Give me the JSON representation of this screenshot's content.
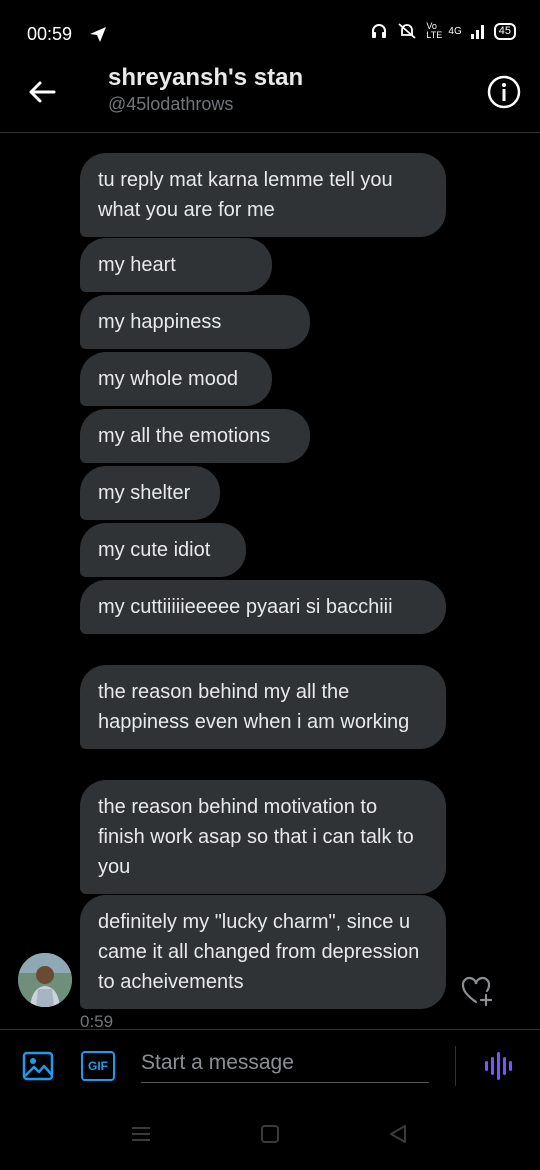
{
  "status_bar": {
    "time": "00:59",
    "battery": "45",
    "network": "4G",
    "volte": "Vo LTE"
  },
  "header": {
    "title": "shreyansh's stan",
    "handle": "@45lodathrows"
  },
  "messages": [
    {
      "text": "tu reply mat karna lemme tell you what you are for me"
    },
    {
      "text": "my heart"
    },
    {
      "text": "my happiness"
    },
    {
      "text": "my whole mood"
    },
    {
      "text": "my all the emotions"
    },
    {
      "text": "my shelter"
    },
    {
      "text": "my cute idiot"
    },
    {
      "text": "my cuttiiiiieeeee pyaari si bacchiii"
    },
    {
      "text": "the reason behind my all the happiness even when i am working"
    },
    {
      "text": "the reason behind motivation to finish work asap so that i can talk to you"
    },
    {
      "text": "definitely my \"lucky charm\", since u came it all changed from depression to acheivements"
    }
  ],
  "last_message_time": "0:59",
  "composer": {
    "placeholder": "Start a message",
    "gif_label": "GIF"
  },
  "colors": {
    "accent": "#1d9bf0",
    "voice": "#7856ff",
    "bubble": "#2f3336",
    "background": "#000000"
  },
  "icons": [
    "back-arrow-icon",
    "info-icon",
    "heart-add-icon",
    "image-icon",
    "gif-icon",
    "voice-icon"
  ]
}
